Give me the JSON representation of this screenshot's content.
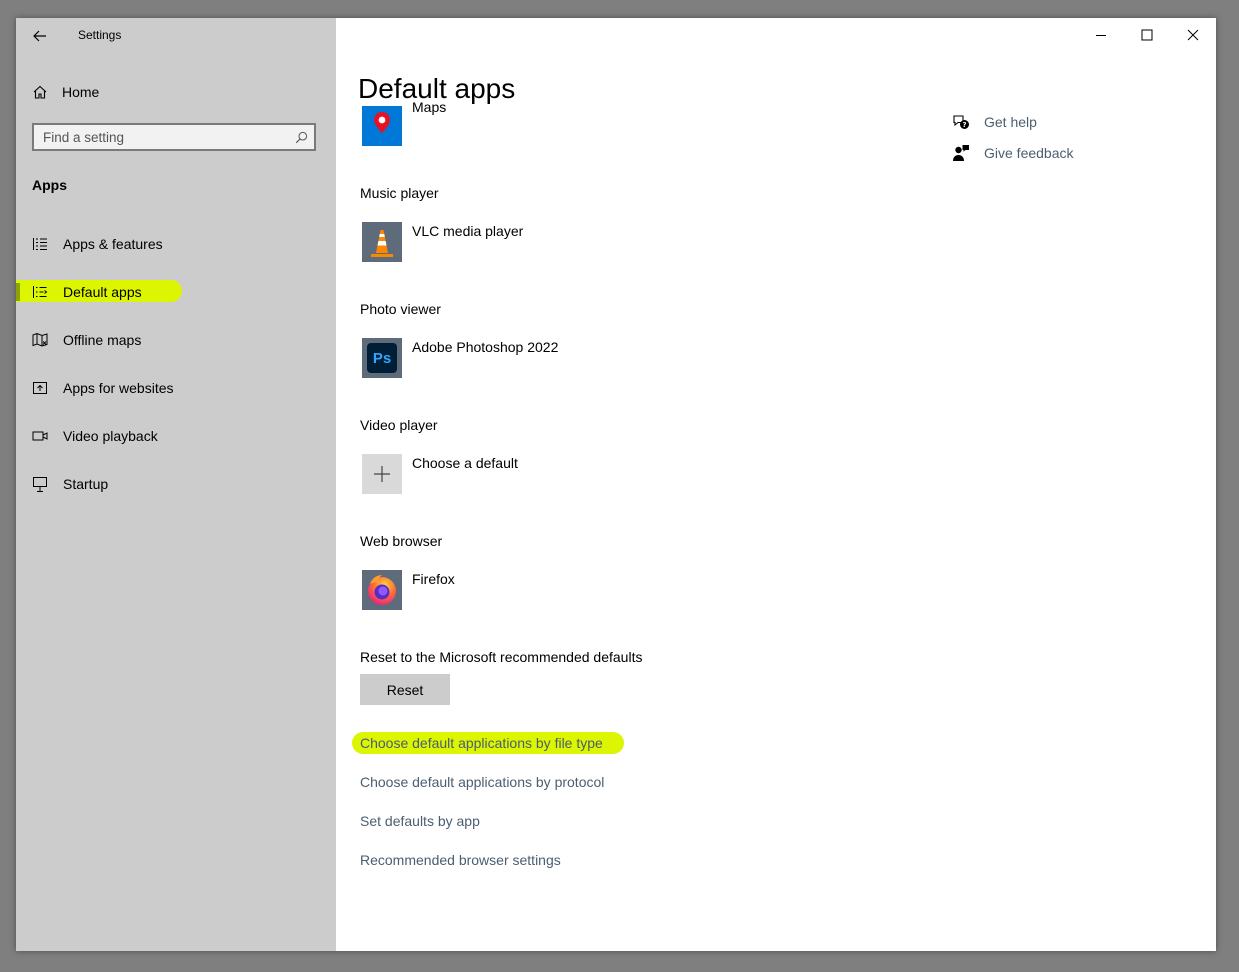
{
  "window": {
    "title": "Settings"
  },
  "sidebar": {
    "home_label": "Home",
    "search_placeholder": "Find a setting",
    "section_heading": "Apps",
    "items": [
      {
        "label": "Apps & features",
        "icon": "list-icon"
      },
      {
        "label": "Default apps",
        "icon": "default-apps-icon",
        "active": true
      },
      {
        "label": "Offline maps",
        "icon": "map-icon"
      },
      {
        "label": "Apps for websites",
        "icon": "website-apps-icon"
      },
      {
        "label": "Video playback",
        "icon": "video-icon"
      },
      {
        "label": "Startup",
        "icon": "startup-icon"
      }
    ]
  },
  "main": {
    "page_title": "Default apps",
    "maps_app": "Maps",
    "categories": [
      {
        "label": "Music player",
        "app": "VLC media player",
        "icon": "vlc-icon"
      },
      {
        "label": "Photo viewer",
        "app": "Adobe Photoshop 2022",
        "icon": "photoshop-icon",
        "icon_text": "Ps"
      },
      {
        "label": "Video player",
        "app": "Choose a default",
        "icon": "plus-icon"
      },
      {
        "label": "Web browser",
        "app": "Firefox",
        "icon": "firefox-icon"
      }
    ],
    "reset_label": "Reset to the Microsoft recommended defaults",
    "reset_button": "Reset",
    "links": [
      "Choose default applications by file type",
      "Choose default applications by protocol",
      "Set defaults by app",
      "Recommended browser settings"
    ]
  },
  "help": {
    "get_help": "Get help",
    "give_feedback": "Give feedback"
  },
  "colors": {
    "sidebar_bg": "#cccccc",
    "highlight": "#dcf500",
    "link": "#4b5e70",
    "maps_tile": "#0078d7",
    "tile_gray": "#5d6b7a",
    "photoshop_bg": "#001e36",
    "photoshop_fg": "#31a8ff"
  }
}
